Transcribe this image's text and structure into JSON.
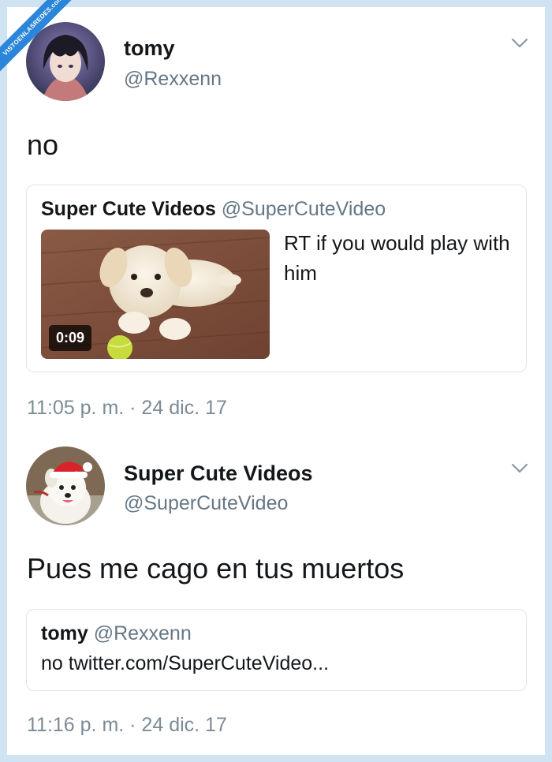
{
  "watermark": {
    "text": "VISTOENLASREDES",
    "suffix": ".com"
  },
  "tweets": [
    {
      "name": "tomy",
      "handle": "@Rexxenn",
      "text": "no",
      "quote": {
        "name": "Super Cute Videos",
        "handle": "@SuperCuteVideo",
        "text": "RT if you would play with him",
        "video_duration": "0:09"
      },
      "timestamp": "11:05 p. m. · 24 dic. 17"
    },
    {
      "name": "Super Cute Videos",
      "handle": "@SuperCuteVideo",
      "text": "Pues me cago en tus muertos",
      "quote": {
        "name": "tomy",
        "handle": "@Rexxenn",
        "text": "no twitter.com/SuperCuteVideo..."
      },
      "timestamp": "11:16 p. m. · 24 dic. 17"
    }
  ],
  "icons": {
    "menu": "chevron-down-icon"
  },
  "colors": {
    "frame": "#cfe3f3",
    "secondary_text": "#657786",
    "border": "#dfe5ea",
    "watermark": "#2b86d9"
  }
}
